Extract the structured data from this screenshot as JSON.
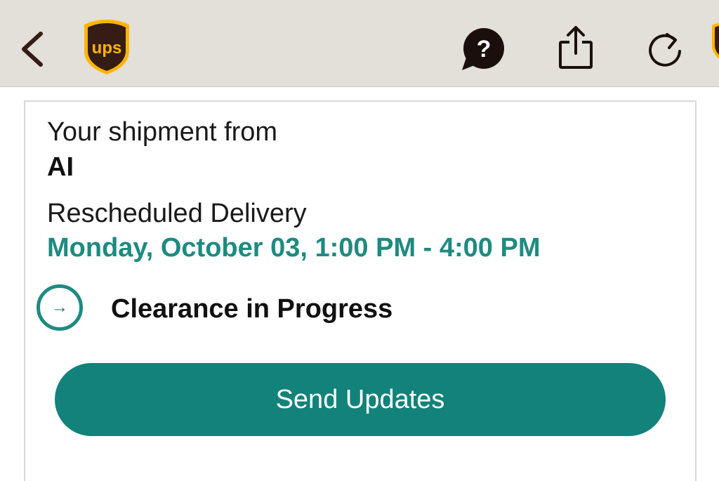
{
  "colors": {
    "brand_brown": "#351c15",
    "brand_gold": "#ffb500",
    "accent_teal": "#12827a",
    "topbar_bg": "#e3dfd9"
  },
  "header": {
    "icons": [
      "back-chevron-icon",
      "ups-logo",
      "help-icon",
      "share-icon",
      "refresh-icon"
    ],
    "logo_text": "ups"
  },
  "shipment": {
    "from_label": "Your shipment from",
    "from_name": "AI",
    "status_label": "Rescheduled Delivery",
    "delivery_window": "Monday, October 03, 1:00 PM - 4:00 PM",
    "progress_icon_glyph": "→",
    "progress_text": "Clearance in Progress"
  },
  "actions": {
    "send_updates_label": "Send Updates"
  }
}
